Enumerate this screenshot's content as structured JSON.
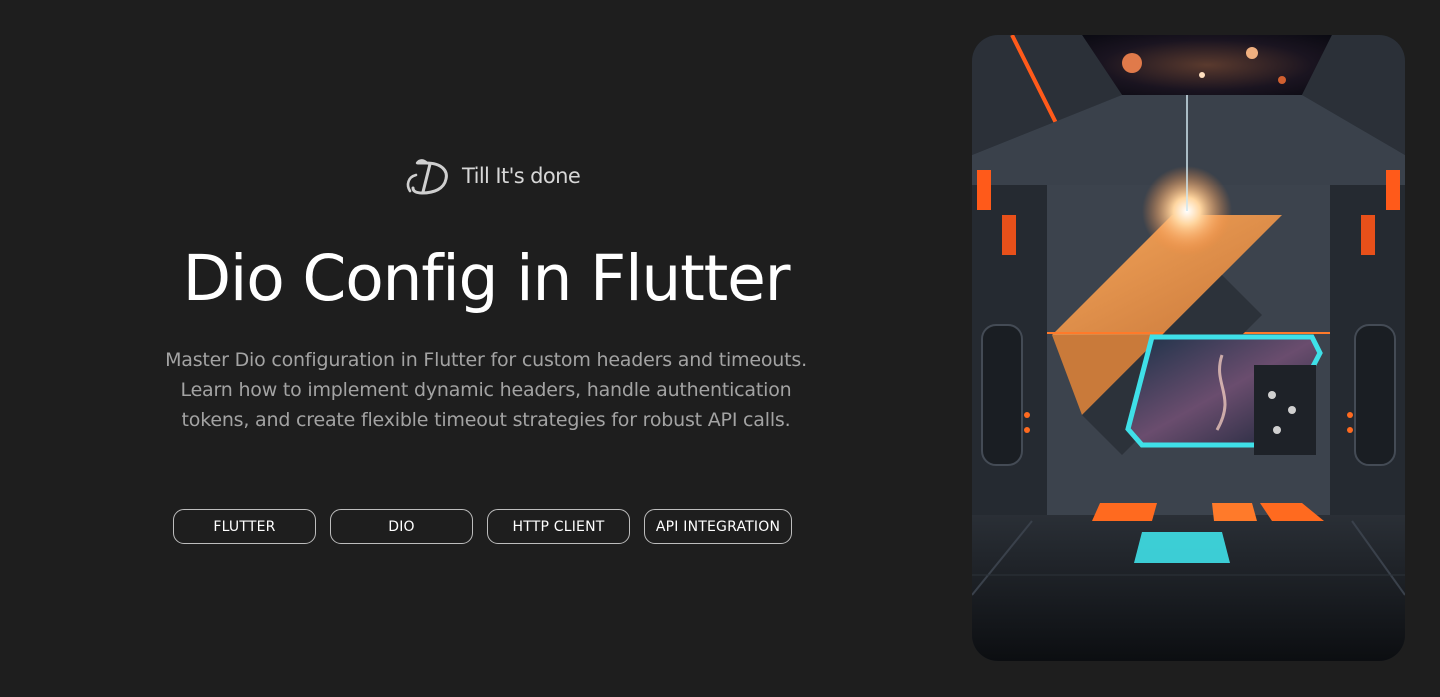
{
  "brand": {
    "name": "Till It's done",
    "logo_icon": "till-its-done-logo-icon"
  },
  "hero": {
    "title": "Dio Config in Flutter",
    "description": "Master Dio configuration in Flutter for custom headers and timeouts. Learn how to implement dynamic headers, handle authentication tokens, and create flexible timeout strategies for robust API calls."
  },
  "tags": [
    {
      "label": "FLUTTER"
    },
    {
      "label": "DIO"
    },
    {
      "label": "HTTP CLIENT"
    },
    {
      "label": "API INTEGRATION"
    }
  ],
  "image": {
    "alt": "Sci-fi spaceship corridor with orange lights and a window looking out to a nebula",
    "accent_orange": "#ff6a1f",
    "accent_cyan": "#3fe0e8"
  },
  "colors": {
    "background": "#1e1e1e",
    "title": "#ffffff",
    "description": "#a3a3a3",
    "tag_border": "#bdbdbd"
  }
}
